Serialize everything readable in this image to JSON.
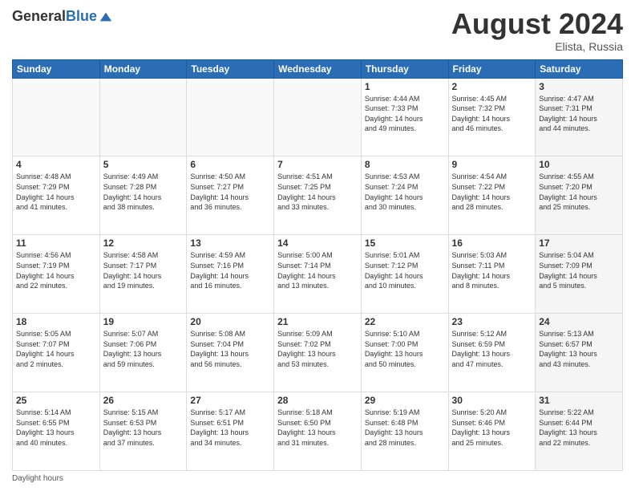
{
  "header": {
    "logo_general": "General",
    "logo_blue": "Blue",
    "month_title": "August 2024",
    "location": "Elista, Russia"
  },
  "weekdays": [
    "Sunday",
    "Monday",
    "Tuesday",
    "Wednesday",
    "Thursday",
    "Friday",
    "Saturday"
  ],
  "footer": {
    "daylight_note": "Daylight hours"
  },
  "weeks": [
    [
      {
        "day": "",
        "info": ""
      },
      {
        "day": "",
        "info": ""
      },
      {
        "day": "",
        "info": ""
      },
      {
        "day": "",
        "info": ""
      },
      {
        "day": "1",
        "info": "Sunrise: 4:44 AM\nSunset: 7:33 PM\nDaylight: 14 hours\nand 49 minutes."
      },
      {
        "day": "2",
        "info": "Sunrise: 4:45 AM\nSunset: 7:32 PM\nDaylight: 14 hours\nand 46 minutes."
      },
      {
        "day": "3",
        "info": "Sunrise: 4:47 AM\nSunset: 7:31 PM\nDaylight: 14 hours\nand 44 minutes."
      }
    ],
    [
      {
        "day": "4",
        "info": "Sunrise: 4:48 AM\nSunset: 7:29 PM\nDaylight: 14 hours\nand 41 minutes."
      },
      {
        "day": "5",
        "info": "Sunrise: 4:49 AM\nSunset: 7:28 PM\nDaylight: 14 hours\nand 38 minutes."
      },
      {
        "day": "6",
        "info": "Sunrise: 4:50 AM\nSunset: 7:27 PM\nDaylight: 14 hours\nand 36 minutes."
      },
      {
        "day": "7",
        "info": "Sunrise: 4:51 AM\nSunset: 7:25 PM\nDaylight: 14 hours\nand 33 minutes."
      },
      {
        "day": "8",
        "info": "Sunrise: 4:53 AM\nSunset: 7:24 PM\nDaylight: 14 hours\nand 30 minutes."
      },
      {
        "day": "9",
        "info": "Sunrise: 4:54 AM\nSunset: 7:22 PM\nDaylight: 14 hours\nand 28 minutes."
      },
      {
        "day": "10",
        "info": "Sunrise: 4:55 AM\nSunset: 7:20 PM\nDaylight: 14 hours\nand 25 minutes."
      }
    ],
    [
      {
        "day": "11",
        "info": "Sunrise: 4:56 AM\nSunset: 7:19 PM\nDaylight: 14 hours\nand 22 minutes."
      },
      {
        "day": "12",
        "info": "Sunrise: 4:58 AM\nSunset: 7:17 PM\nDaylight: 14 hours\nand 19 minutes."
      },
      {
        "day": "13",
        "info": "Sunrise: 4:59 AM\nSunset: 7:16 PM\nDaylight: 14 hours\nand 16 minutes."
      },
      {
        "day": "14",
        "info": "Sunrise: 5:00 AM\nSunset: 7:14 PM\nDaylight: 14 hours\nand 13 minutes."
      },
      {
        "day": "15",
        "info": "Sunrise: 5:01 AM\nSunset: 7:12 PM\nDaylight: 14 hours\nand 10 minutes."
      },
      {
        "day": "16",
        "info": "Sunrise: 5:03 AM\nSunset: 7:11 PM\nDaylight: 14 hours\nand 8 minutes."
      },
      {
        "day": "17",
        "info": "Sunrise: 5:04 AM\nSunset: 7:09 PM\nDaylight: 14 hours\nand 5 minutes."
      }
    ],
    [
      {
        "day": "18",
        "info": "Sunrise: 5:05 AM\nSunset: 7:07 PM\nDaylight: 14 hours\nand 2 minutes."
      },
      {
        "day": "19",
        "info": "Sunrise: 5:07 AM\nSunset: 7:06 PM\nDaylight: 13 hours\nand 59 minutes."
      },
      {
        "day": "20",
        "info": "Sunrise: 5:08 AM\nSunset: 7:04 PM\nDaylight: 13 hours\nand 56 minutes."
      },
      {
        "day": "21",
        "info": "Sunrise: 5:09 AM\nSunset: 7:02 PM\nDaylight: 13 hours\nand 53 minutes."
      },
      {
        "day": "22",
        "info": "Sunrise: 5:10 AM\nSunset: 7:00 PM\nDaylight: 13 hours\nand 50 minutes."
      },
      {
        "day": "23",
        "info": "Sunrise: 5:12 AM\nSunset: 6:59 PM\nDaylight: 13 hours\nand 47 minutes."
      },
      {
        "day": "24",
        "info": "Sunrise: 5:13 AM\nSunset: 6:57 PM\nDaylight: 13 hours\nand 43 minutes."
      }
    ],
    [
      {
        "day": "25",
        "info": "Sunrise: 5:14 AM\nSunset: 6:55 PM\nDaylight: 13 hours\nand 40 minutes."
      },
      {
        "day": "26",
        "info": "Sunrise: 5:15 AM\nSunset: 6:53 PM\nDaylight: 13 hours\nand 37 minutes."
      },
      {
        "day": "27",
        "info": "Sunrise: 5:17 AM\nSunset: 6:51 PM\nDaylight: 13 hours\nand 34 minutes."
      },
      {
        "day": "28",
        "info": "Sunrise: 5:18 AM\nSunset: 6:50 PM\nDaylight: 13 hours\nand 31 minutes."
      },
      {
        "day": "29",
        "info": "Sunrise: 5:19 AM\nSunset: 6:48 PM\nDaylight: 13 hours\nand 28 minutes."
      },
      {
        "day": "30",
        "info": "Sunrise: 5:20 AM\nSunset: 6:46 PM\nDaylight: 13 hours\nand 25 minutes."
      },
      {
        "day": "31",
        "info": "Sunrise: 5:22 AM\nSunset: 6:44 PM\nDaylight: 13 hours\nand 22 minutes."
      }
    ]
  ]
}
